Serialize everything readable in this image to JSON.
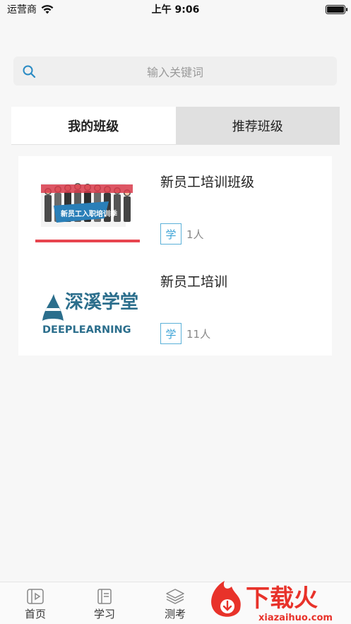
{
  "status_bar": {
    "carrier": "运营商",
    "time": "上午 9:06"
  },
  "search": {
    "placeholder": "输入关键词"
  },
  "tabs": [
    {
      "label": "我的班级",
      "active": true
    },
    {
      "label": "推荐班级",
      "active": false
    }
  ],
  "classes": [
    {
      "title": "新员工培训班级",
      "role": "学",
      "members": "1人",
      "thumb_text": "新员工入职培训季"
    },
    {
      "title": "新员工培训",
      "role": "学",
      "members": "11人",
      "thumb_text_cn": "深溪学堂",
      "thumb_text_en": "DEEPLEARNING"
    }
  ],
  "bottom_nav": [
    {
      "label": "首页",
      "icon": "home-video-icon"
    },
    {
      "label": "学习",
      "icon": "notebook-icon"
    },
    {
      "label": "测考",
      "icon": "layers-icon"
    }
  ],
  "watermark": {
    "text_cn": "下载火",
    "text_en": "xiazaihuo.com"
  },
  "colors": {
    "accent": "#3ca3d6",
    "tab_inactive_bg": "#e0e0e0",
    "page_bg": "#f7f7f7",
    "watermark_red": "#e8322a"
  }
}
